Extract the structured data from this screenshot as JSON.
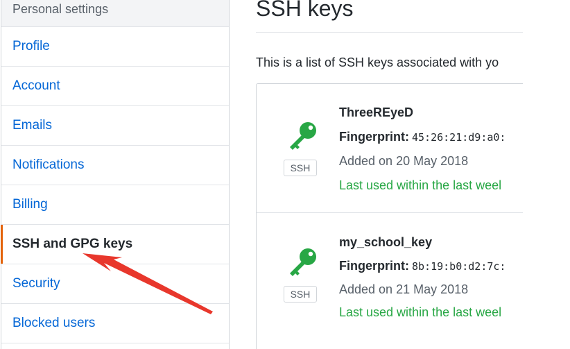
{
  "sidebar": {
    "header": "Personal settings",
    "items": [
      {
        "label": "Profile"
      },
      {
        "label": "Account"
      },
      {
        "label": "Emails"
      },
      {
        "label": "Notifications"
      },
      {
        "label": "Billing"
      },
      {
        "label": "SSH and GPG keys",
        "selected": true
      },
      {
        "label": "Security"
      },
      {
        "label": "Blocked users"
      }
    ]
  },
  "main": {
    "title": "SSH keys",
    "intro": "This is a list of SSH keys associated with yo",
    "keys": [
      {
        "name": "ThreeREyeD",
        "fingerprint_label": "Fingerprint:",
        "fingerprint": "45:26:21:d9:a0:",
        "badge": "SSH",
        "added": "Added on 20 May 2018",
        "last_used": "Last used within the last weel",
        "icon": "key-icon"
      },
      {
        "name": "my_school_key",
        "fingerprint_label": "Fingerprint:",
        "fingerprint": "8b:19:b0:d2:7c:",
        "badge": "SSH",
        "added": "Added on 21 May 2018",
        "last_used": "Last used within the last weel",
        "icon": "key-icon"
      }
    ]
  },
  "colors": {
    "link": "#0366d6",
    "selected_bar": "#e36209",
    "key_icon": "#28a745",
    "last_used_text": "#28a745",
    "annotation_arrow": "#e8372c"
  }
}
